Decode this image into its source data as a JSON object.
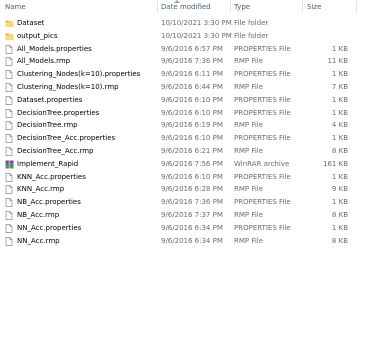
{
  "columns": {
    "name": "Name",
    "date": "Date modified",
    "type": "Type",
    "size": "Size"
  },
  "files": [
    {
      "name": "Dataset",
      "date": "10/10/2021 3:30 PM",
      "type": "File folder",
      "size": "",
      "icon": "folder-icon"
    },
    {
      "name": "output_pics",
      "date": "10/10/2021 3:30 PM",
      "type": "File folder",
      "size": "",
      "icon": "folder-icon"
    },
    {
      "name": "All_Models.properties",
      "date": "9/6/2016 6:57 PM",
      "type": "PROPERTIES File",
      "size": "1 KB",
      "icon": "document-icon"
    },
    {
      "name": "All_Models.rmp",
      "date": "9/6/2016 7:36 PM",
      "type": "RMP File",
      "size": "11 KB",
      "icon": "document-icon"
    },
    {
      "name": "Clustering_Nodes(k=10).properties",
      "date": "9/6/2016 6:11 PM",
      "type": "PROPERTIES File",
      "size": "1 KB",
      "icon": "document-icon"
    },
    {
      "name": "Clustering_Nodes(k=10).rmp",
      "date": "9/6/2016 6:44 PM",
      "type": "RMP File",
      "size": "7 KB",
      "icon": "document-icon"
    },
    {
      "name": "Dataset.properties",
      "date": "9/6/2016 6:10 PM",
      "type": "PROPERTIES File",
      "size": "1 KB",
      "icon": "document-icon"
    },
    {
      "name": "DecisionTree.properties",
      "date": "9/6/2016 6:10 PM",
      "type": "PROPERTIES File",
      "size": "1 KB",
      "icon": "document-icon"
    },
    {
      "name": "DecisionTree.rmp",
      "date": "9/6/2016 6:19 PM",
      "type": "RMP File",
      "size": "4 KB",
      "icon": "document-icon"
    },
    {
      "name": "DecisionTree_Acc.properties",
      "date": "9/6/2016 6:10 PM",
      "type": "PROPERTIES File",
      "size": "1 KB",
      "icon": "document-icon"
    },
    {
      "name": "DecisionTree_Acc.rmp",
      "date": "9/6/2016 6:21 PM",
      "type": "RMP File",
      "size": "8 KB",
      "icon": "document-icon"
    },
    {
      "name": "Implement_Rapid",
      "date": "9/6/2016 7:56 PM",
      "type": "WinRAR archive",
      "size": "161 KB",
      "icon": "archive-icon"
    },
    {
      "name": "KNN_Acc.properties",
      "date": "9/6/2016 6:10 PM",
      "type": "PROPERTIES File",
      "size": "1 KB",
      "icon": "document-icon"
    },
    {
      "name": "KNN_Acc.rmp",
      "date": "9/6/2016 6:28 PM",
      "type": "RMP File",
      "size": "9 KB",
      "icon": "document-icon"
    },
    {
      "name": "NB_Acc.properties",
      "date": "9/6/2016 7:36 PM",
      "type": "PROPERTIES File",
      "size": "1 KB",
      "icon": "document-icon"
    },
    {
      "name": "NB_Acc.rmp",
      "date": "9/6/2016 7:37 PM",
      "type": "RMP File",
      "size": "8 KB",
      "icon": "document-icon"
    },
    {
      "name": "NN_Acc.properties",
      "date": "9/6/2016 6:34 PM",
      "type": "PROPERTIES File",
      "size": "1 KB",
      "icon": "document-icon"
    },
    {
      "name": "NN_Acc.rmp",
      "date": "9/6/2016 6:34 PM",
      "type": "RMP File",
      "size": "8 KB",
      "icon": "document-icon"
    }
  ],
  "colors": {
    "header_text": "#4c607a",
    "secondary_text": "#6d6d6d",
    "folder_yellow": "#f8d775",
    "folder_dark": "#e0b03c"
  }
}
